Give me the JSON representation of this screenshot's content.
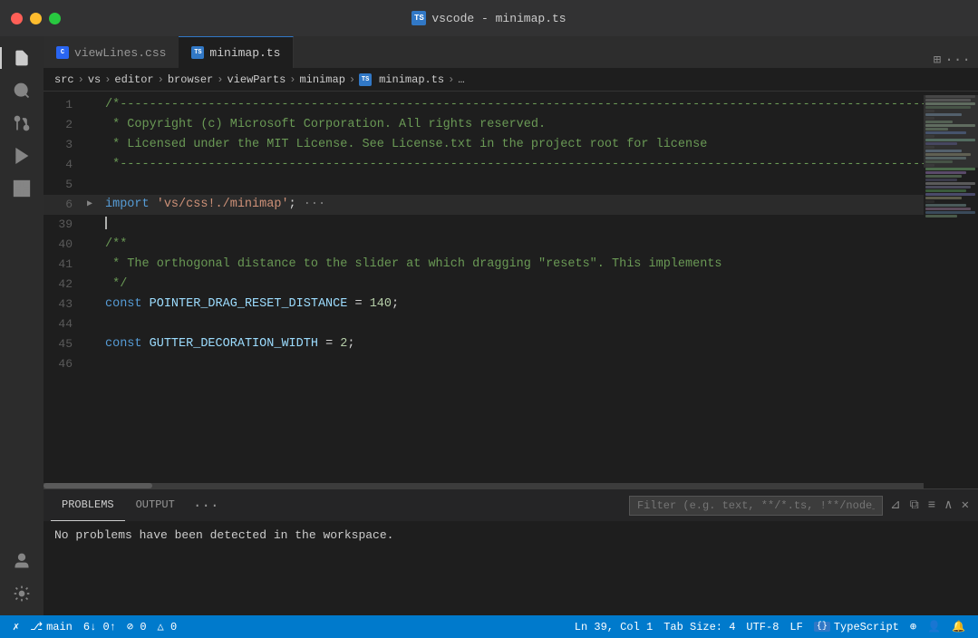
{
  "window": {
    "title": "vscode - minimap.ts"
  },
  "tabs": [
    {
      "id": "viewLines",
      "label": "viewLines.css",
      "type": "css",
      "active": false
    },
    {
      "id": "minimap",
      "label": "minimap.ts",
      "type": "ts",
      "active": true
    }
  ],
  "breadcrumb": {
    "parts": [
      "src",
      "vs",
      "editor",
      "browser",
      "viewParts",
      "minimap",
      "minimap.ts",
      "..."
    ]
  },
  "code": {
    "lines": [
      {
        "num": 1,
        "content": "/*----------------------------------------------------------------------",
        "type": "comment"
      },
      {
        "num": 2,
        "content": " * Copyright (c) Microsoft Corporation. All rights reserved.",
        "type": "comment"
      },
      {
        "num": 3,
        "content": " * Licensed under the MIT License. See License.txt in the project root for license",
        "type": "comment"
      },
      {
        "num": 4,
        "content": " *---------------------------------------------------------------------",
        "type": "comment"
      },
      {
        "num": 5,
        "content": "",
        "type": "empty"
      },
      {
        "num": 6,
        "content": "import 'vs/css!./minimap'; ···",
        "type": "import",
        "folded": true
      },
      {
        "num": 39,
        "content": "",
        "type": "cursor"
      },
      {
        "num": 40,
        "content": "/**",
        "type": "jsdoc"
      },
      {
        "num": 41,
        "content": " * The orthogonal distance to the slider at which dragging \"resets\". This implements",
        "type": "jsdoc"
      },
      {
        "num": 42,
        "content": " */",
        "type": "jsdoc"
      },
      {
        "num": 43,
        "content": "const POINTER_DRAG_RESET_DISTANCE = 140;",
        "type": "const"
      },
      {
        "num": 44,
        "content": "",
        "type": "empty"
      },
      {
        "num": 45,
        "content": "const GUTTER_DECORATION_WIDTH = 2;",
        "type": "const"
      },
      {
        "num": 46,
        "content": "",
        "type": "empty"
      }
    ]
  },
  "panel": {
    "tabs": [
      "PROBLEMS",
      "OUTPUT"
    ],
    "active_tab": "PROBLEMS",
    "filter_placeholder": "Filter (e.g. text, **/*.ts, !**/node_modules/**)",
    "message": "No problems have been detected in the workspace."
  },
  "status_bar": {
    "branch": "main",
    "sync": "6↓ 0↑",
    "errors": "⊘ 0",
    "warnings": "△ 0",
    "position": "Ln 39, Col 1",
    "tab_size": "Tab Size: 4",
    "encoding": "UTF-8",
    "line_ending": "LF",
    "language": "TypeScript",
    "live_share_icon": "⊕",
    "accounts_icon": "👤",
    "bell_icon": "🔔",
    "remote_icon": "✗"
  },
  "activity_bar": {
    "icons": [
      "files",
      "search",
      "git",
      "run",
      "extensions",
      "settings",
      "account"
    ]
  }
}
